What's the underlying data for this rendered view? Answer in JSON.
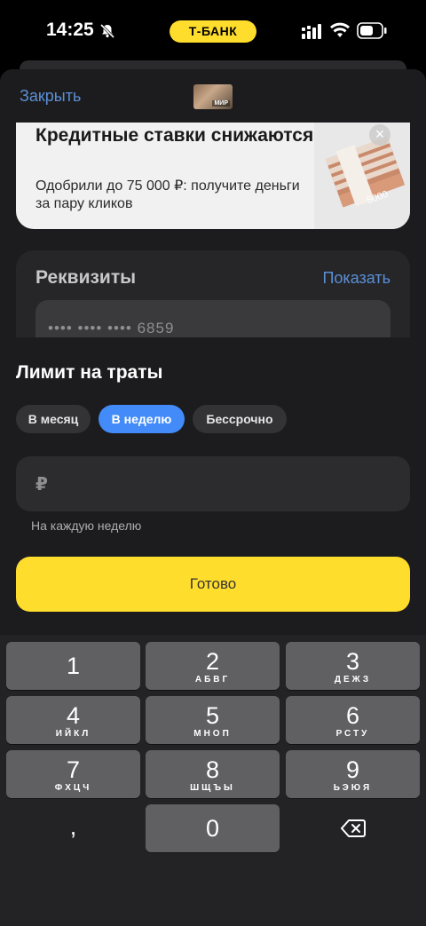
{
  "status_bar": {
    "time": "14:25",
    "carrier": "Т-БАНК"
  },
  "header": {
    "close_label": "Закрыть",
    "card_badge": "МИР"
  },
  "promo": {
    "title": "Кредитные ставки снижаются",
    "text": "Одобрили до 75 000 ₽: получите деньги за пару кликов",
    "banknote_value": "5000"
  },
  "requisites": {
    "title": "Реквизиты",
    "show_label": "Показать",
    "card_number": "•••• •••• •••• 6859"
  },
  "limit_sheet": {
    "title": "Лимит на траты",
    "periods": [
      {
        "label": "В месяц",
        "active": false
      },
      {
        "label": "В неделю",
        "active": true
      },
      {
        "label": "Бессрочно",
        "active": false
      }
    ],
    "currency_symbol": "₽",
    "amount_value": "",
    "hint": "На каждую неделю",
    "done_label": "Готово"
  },
  "keyboard": {
    "keys": [
      {
        "num": "1",
        "letters": ""
      },
      {
        "num": "2",
        "letters": "АБВГ"
      },
      {
        "num": "3",
        "letters": "ДЕЖЗ"
      },
      {
        "num": "4",
        "letters": "ИЙКЛ"
      },
      {
        "num": "5",
        "letters": "МНОП"
      },
      {
        "num": "6",
        "letters": "РСТУ"
      },
      {
        "num": "7",
        "letters": "ФХЦЧ"
      },
      {
        "num": "8",
        "letters": "ШЩЪЫ"
      },
      {
        "num": "9",
        "letters": "ЬЭЮЯ"
      },
      {
        "num": ",",
        "letters": ""
      },
      {
        "num": "0",
        "letters": ""
      }
    ]
  },
  "colors": {
    "accent_yellow": "#ffdd2d",
    "active_chip": "#428bf9",
    "link_blue": "#5a8fd6"
  }
}
